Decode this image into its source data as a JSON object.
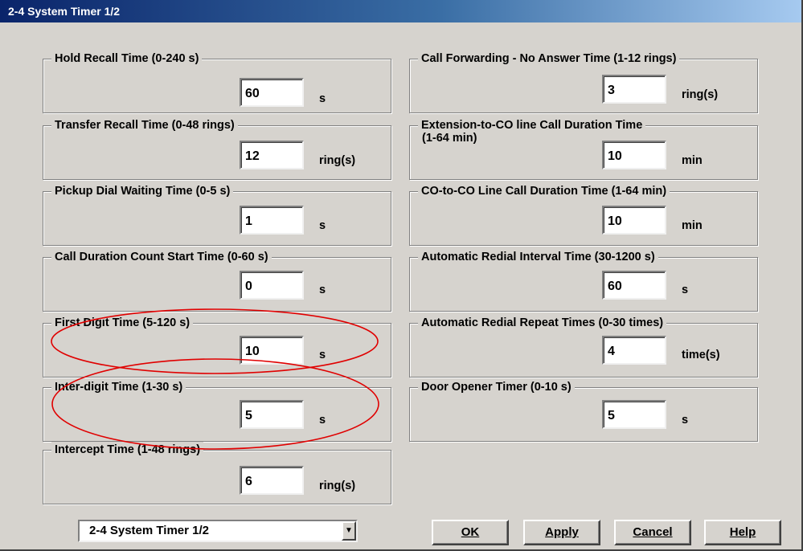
{
  "window": {
    "title": "2-4 System Timer 1/2"
  },
  "left_groups": [
    {
      "label": "Hold Recall Time (0-240 s)",
      "value": "60",
      "unit": "s"
    },
    {
      "label": "Transfer Recall Time (0-48 rings)",
      "value": "12",
      "unit": "ring(s)"
    },
    {
      "label": "Pickup Dial Waiting Time (0-5 s)",
      "value": "1",
      "unit": "s"
    },
    {
      "label": "Call Duration Count Start Time (0-60 s)",
      "value": "0",
      "unit": "s"
    },
    {
      "label": "First Digit Time (5-120 s)",
      "value": "10",
      "unit": "s"
    },
    {
      "label": "Inter-digit Time (1-30 s)",
      "value": "5",
      "unit": "s"
    },
    {
      "label": "Intercept Time (1-48 rings)",
      "value": "6",
      "unit": "ring(s)"
    }
  ],
  "right_groups": [
    {
      "label": "Call Forwarding - No Answer Time (1-12 rings)",
      "value": "3",
      "unit": "ring(s)"
    },
    {
      "label": "Extension-to-CO line Call Duration Time",
      "label2": "(1-64 min)",
      "value": "10",
      "unit": "min"
    },
    {
      "label": "CO-to-CO Line Call Duration Time (1-64 min)",
      "value": "10",
      "unit": "min"
    },
    {
      "label": "Automatic Redial Interval Time (30-1200 s)",
      "value": "60",
      "unit": "s"
    },
    {
      "label": "Automatic Redial Repeat Times (0-30 times)",
      "value": "4",
      "unit": "time(s)"
    },
    {
      "label": "Door Opener Timer (0-10 s)",
      "value": "5",
      "unit": "s"
    }
  ],
  "page_select": {
    "value": "2-4 System Timer 1/2"
  },
  "buttons": {
    "ok": "OK",
    "apply": "Apply",
    "cancel": "Cancel",
    "help": "Help"
  },
  "colors": {
    "dialog_bg": "#d6d3ce",
    "title_start": "#0a246a",
    "annotation": "#e00000"
  }
}
